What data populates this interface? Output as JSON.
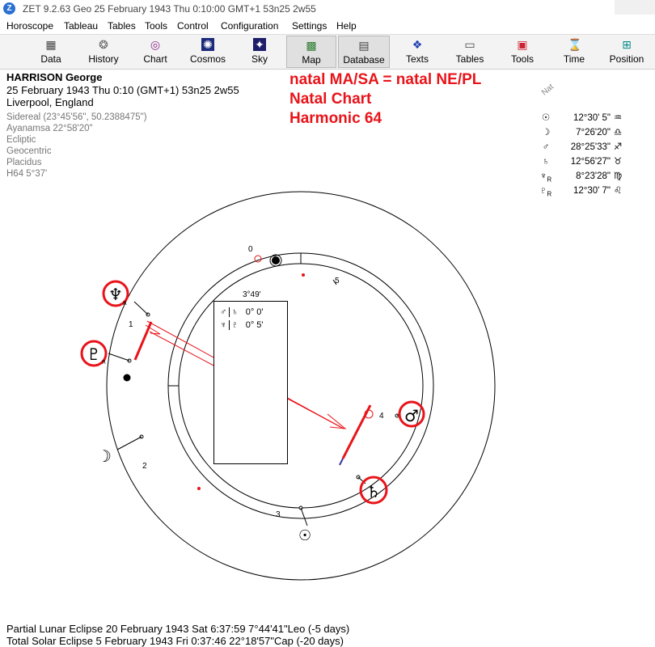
{
  "window": {
    "title": "ZET 9.2.63 Geo   25 February 1943  Thu   0:10:00 GMT+1 53n25  2w55",
    "app_icon": "zet-app-icon"
  },
  "menu": [
    {
      "label": "Horoscope"
    },
    {
      "label": "Tableau"
    },
    {
      "label": "Tables"
    },
    {
      "label": "Tools"
    },
    {
      "label": "Control"
    },
    {
      "label": "Configuration"
    },
    {
      "label": "Settings"
    },
    {
      "label": "Help"
    }
  ],
  "toolbar": [
    {
      "label": "Data",
      "icon": "data-grid-icon",
      "glyph": "▦"
    },
    {
      "label": "History",
      "icon": "history-icon",
      "glyph": "❂"
    },
    {
      "label": "Chart",
      "icon": "chart-wheel-icon",
      "glyph": "◎"
    },
    {
      "label": "Cosmos",
      "icon": "cosmos-icon",
      "glyph": "✺"
    },
    {
      "label": "Sky",
      "icon": "sky-icon",
      "glyph": "✦"
    },
    {
      "label": "Map",
      "icon": "map-icon",
      "glyph": "▩"
    },
    {
      "label": "Database",
      "icon": "database-icon",
      "glyph": "▤"
    },
    {
      "label": "Texts",
      "icon": "texts-icon",
      "glyph": "❖"
    },
    {
      "label": "Tables",
      "icon": "tables-icon",
      "glyph": "▭"
    },
    {
      "label": "Tools",
      "icon": "tools-icon",
      "glyph": "▣"
    },
    {
      "label": "Time",
      "icon": "time-icon",
      "glyph": "⌛"
    },
    {
      "label": "Position",
      "icon": "position-icon",
      "glyph": "⊞"
    }
  ],
  "person": {
    "name": "HARRISON George",
    "date_line": "25 February 1943  Thu   0:10  (GMT+1)  53n25   2w55",
    "place": "Liverpool, England"
  },
  "settings": [
    "Sidereal (23°45'56\", 50.2388475\")",
    "Ayanamsa 22°58'20\"",
    "Ecliptic",
    "Geocentric",
    "Placidus",
    "H64   5°37'"
  ],
  "annotation": {
    "line1": "natal MA/SA = natal NE/PL",
    "line2": "Natal Chart",
    "line3": "Harmonic 64",
    "color": "#e8141a"
  },
  "positions_header": "Nat",
  "positions": [
    {
      "planet": "sun",
      "glyph": "☉",
      "retro": "",
      "value": "12°30' 5\"",
      "sign": "♒"
    },
    {
      "planet": "moon",
      "glyph": "☽",
      "retro": "",
      "value": "7°26'20\"",
      "sign": "♎"
    },
    {
      "planet": "mars",
      "glyph": "♂",
      "retro": "",
      "value": "28°25'33\"",
      "sign": "♐"
    },
    {
      "planet": "saturn",
      "glyph": "♄",
      "retro": "",
      "value": "12°56'27\"",
      "sign": "♉"
    },
    {
      "planet": "neptune",
      "glyph": "♆",
      "retro": "R",
      "value": "8°23'28\"",
      "sign": "♍"
    },
    {
      "planet": "pluto",
      "glyph": "♇",
      "retro": "R",
      "value": "12°30' 7\"",
      "sign": "♌"
    }
  ],
  "aspect_grid": {
    "orb": "3°49'",
    "rows": [
      {
        "left": "♂",
        "mid": "♄",
        "value": "0° 0'"
      },
      {
        "left": "♆",
        "mid": "♇",
        "value": "0° 5'"
      }
    ]
  },
  "wheel": {
    "house_numbers": [
      "0",
      "1",
      "2",
      "3",
      "4",
      "5"
    ],
    "planets": [
      {
        "name": "neptune",
        "glyph": "♆",
        "retro": "R",
        "circled": true
      },
      {
        "name": "pluto",
        "glyph": "♇",
        "retro": "R",
        "circled": true
      },
      {
        "name": "mars",
        "glyph": "♂",
        "retro": "",
        "circled": true
      },
      {
        "name": "saturn",
        "glyph": "♄",
        "retro": "",
        "circled": true
      },
      {
        "name": "moon",
        "glyph": "☽",
        "retro": "",
        "circled": false
      },
      {
        "name": "sun",
        "glyph": "☉",
        "retro": "",
        "circled": false
      }
    ],
    "highlight_color": "#e8141a"
  },
  "eclipses": [
    "Partial Lunar Eclipse 20 February 1943 Sat  6:37:59  7°44'41\"Leo (-5 days)",
    "Total Solar Eclipse 5 February 1943 Fri  0:37:46 22°18'57\"Cap (-20 days)"
  ]
}
